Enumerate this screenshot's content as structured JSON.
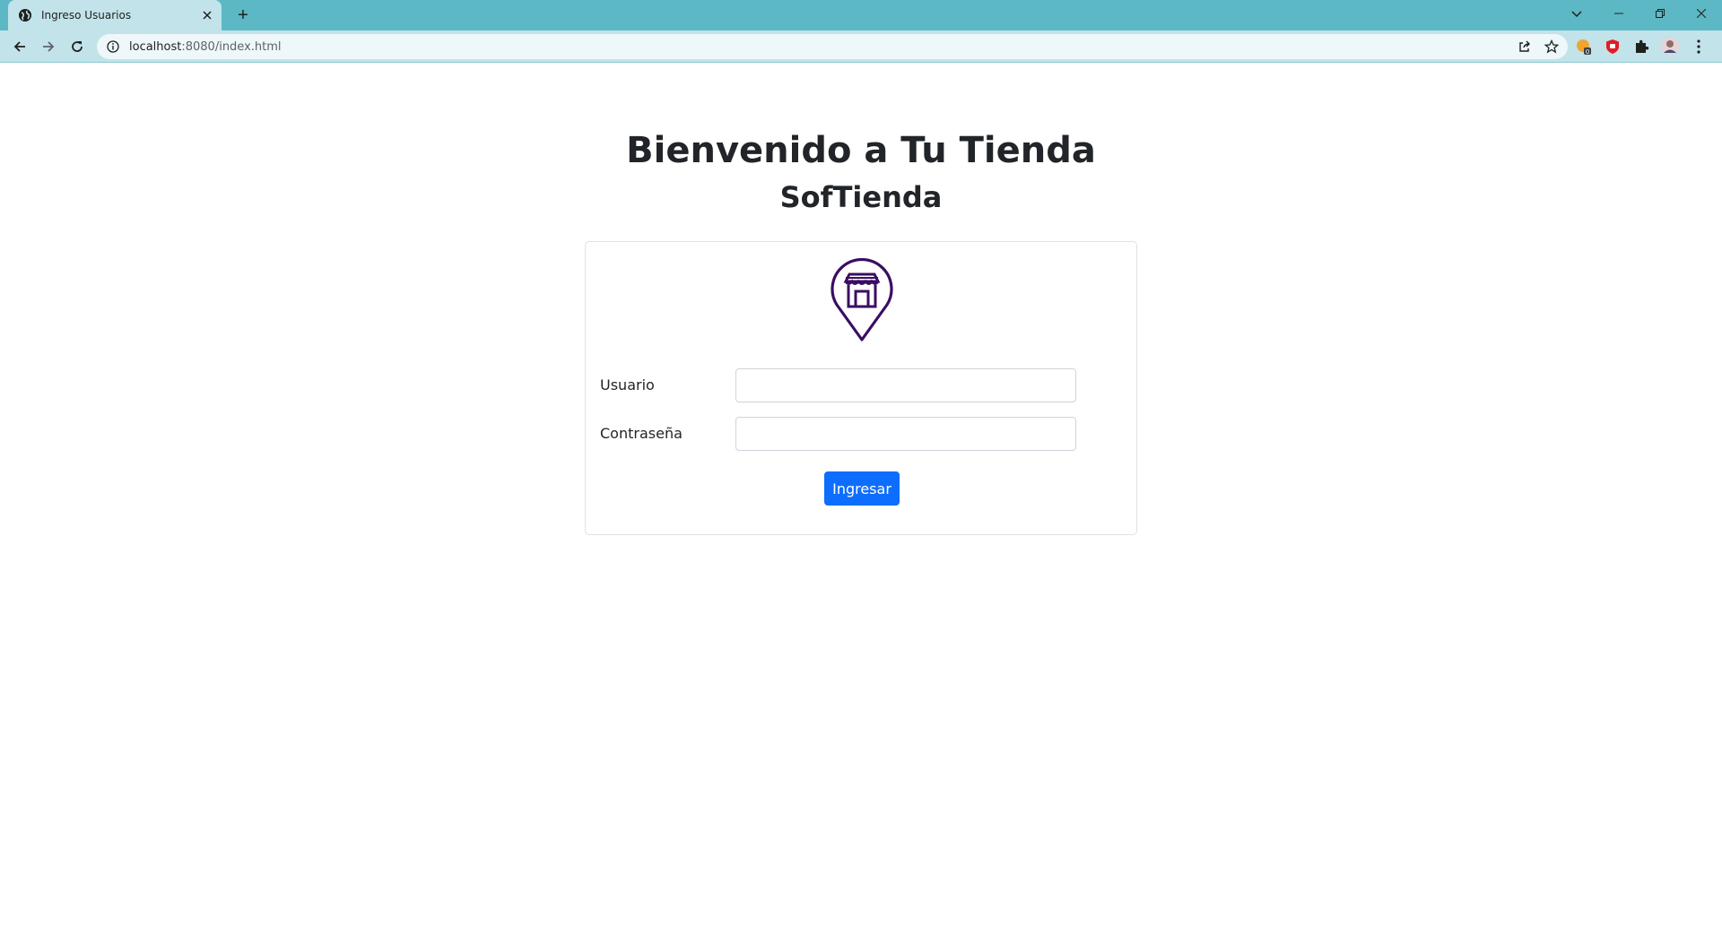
{
  "browser": {
    "tab": {
      "title": "Ingreso Usuarios",
      "favicon": "globe-icon"
    },
    "new_tab_symbol": "+",
    "address": {
      "host": "localhost",
      "path": ":8080/index.html"
    },
    "extensions": [
      "share-icon",
      "star-icon",
      "extension-badge-icon",
      "shield-extension-icon",
      "puzzle-icon",
      "profile-avatar",
      "menu-kebab-icon"
    ]
  },
  "page": {
    "title": "Bienvenido a Tu Tienda",
    "subtitle": "SofTienda",
    "logo_icon": "store-location-pin-icon",
    "logo_color": "#3a0e63",
    "form": {
      "user_label": "Usuario",
      "user_value": "",
      "password_label": "Contraseña",
      "password_value": "",
      "submit_label": "Ingresar"
    }
  },
  "colors": {
    "chrome_frame": "#5bb8c4",
    "chrome_toolbar": "#c1e3e9",
    "primary_button": "#0d6efd"
  }
}
